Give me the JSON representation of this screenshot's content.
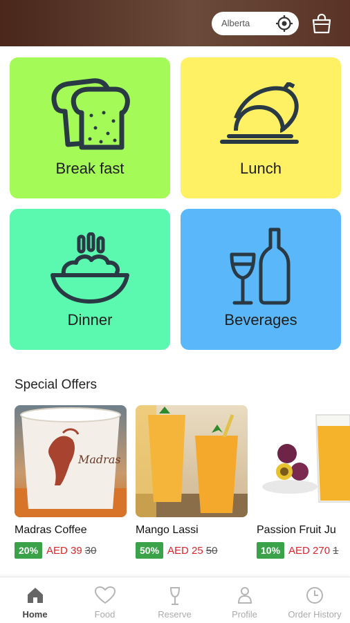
{
  "header": {
    "location": "Alberta",
    "location_icon": "gps-target-icon",
    "cart_icon": "shopping-bag-icon"
  },
  "categories": [
    {
      "label": "Break fast",
      "icon": "bread-icon",
      "color": "#a4fb58"
    },
    {
      "label": "Lunch",
      "icon": "cloche-icon",
      "color": "#fff064"
    },
    {
      "label": "Dinner",
      "icon": "bowl-icon",
      "color": "#5bf8b0"
    },
    {
      "label": "Beverages",
      "icon": "wine-bottle-icon",
      "color": "#5ab8fa"
    }
  ],
  "special_offers": {
    "title": "Special Offers",
    "items": [
      {
        "name": "Madras Coffee",
        "discount": "20%",
        "price": "AED 39",
        "old_price": "30"
      },
      {
        "name": "Mango Lassi",
        "discount": "50%",
        "price": "AED 25",
        "old_price": "50"
      },
      {
        "name": "Passion Fruit Ju",
        "discount": "10%",
        "price": "AED 270",
        "old_price": "1"
      }
    ],
    "cup_text": "Madras"
  },
  "bottom_nav": [
    {
      "label": "Home",
      "icon": "home-icon",
      "active": true
    },
    {
      "label": "Food",
      "icon": "heart-icon",
      "active": false
    },
    {
      "label": "Reserve",
      "icon": "wine-glass-icon",
      "active": false
    },
    {
      "label": "Profile",
      "icon": "person-icon",
      "active": false
    },
    {
      "label": "Order History",
      "icon": "clock-icon",
      "active": false
    }
  ],
  "colors": {
    "header": "#4a261b",
    "discount_badge": "#3aa34a",
    "price": "#d9262b"
  }
}
